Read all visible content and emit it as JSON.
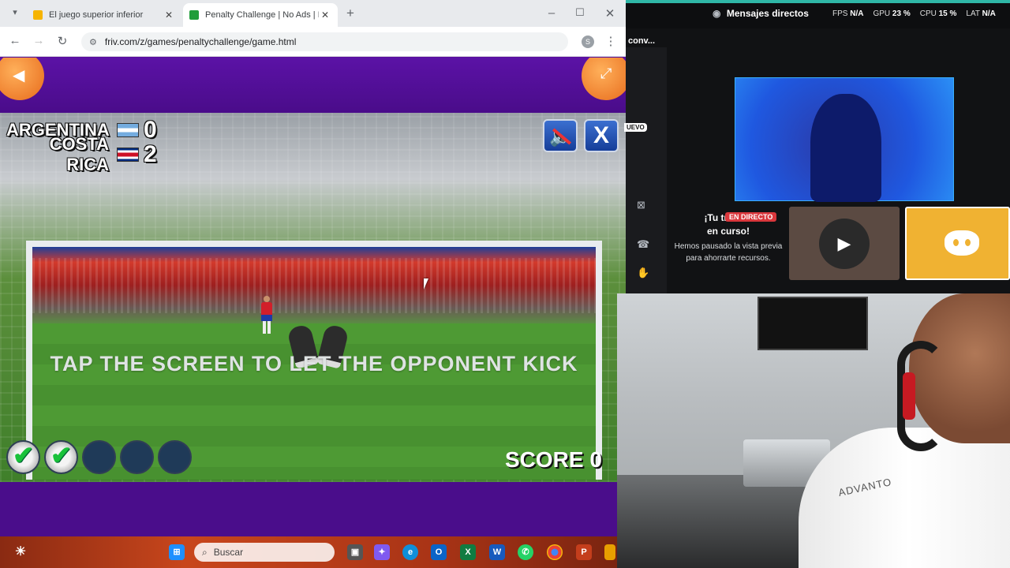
{
  "browser": {
    "tabs": [
      {
        "title": "El juego superior inferior",
        "active": false
      },
      {
        "title": "Penalty Challenge | No Ads | Pla",
        "active": true
      }
    ],
    "url": "friv.com/z/games/penaltychallenge/game.html",
    "profile_initial": "S"
  },
  "game": {
    "teams": [
      {
        "name": "ARGENTINA",
        "score": "0"
      },
      {
        "name": "COSTA RICA",
        "score": "2"
      }
    ],
    "close_label": "X",
    "instruction": "TAP THE SCREEN TO LET THE OPPONENT KICK",
    "score_label": "SCORE 0",
    "attempts": [
      "done",
      "done",
      "empty",
      "empty",
      "empty"
    ]
  },
  "taskbar": {
    "search_placeholder": "Buscar",
    "pinned_apps": [
      "file-explorer",
      "copilot",
      "edge",
      "outlook",
      "excel",
      "word",
      "whatsapp",
      "chrome",
      "powerpoint",
      "other"
    ]
  },
  "discord": {
    "direct_messages": "Mensajes directos",
    "stats": {
      "fps_label": "FPS",
      "fps": "N/A",
      "gpu_label": "GPU",
      "gpu": "23 %",
      "cpu_label": "CPU",
      "cpu": "15 %",
      "lat_label": "LAT",
      "lat": "N/A"
    },
    "conv_label": "conv...",
    "nuevo_badge": "UEVO",
    "live_badge": "EN DIRECTO",
    "paused_title": "¡Tu transm... en curso!",
    "paused_title_a": "¡Tu transm",
    "paused_title_b": "en curso!",
    "paused_message": "Hemos pausado la vista previa para ahorrarte recursos."
  },
  "webcam": {
    "shirt_text": "ADVANTO"
  },
  "colors": {
    "game_purple": "#55109a",
    "corner_orange": "#e76a1b",
    "discord_yellow": "#f0b232",
    "live_red": "#da373c"
  }
}
